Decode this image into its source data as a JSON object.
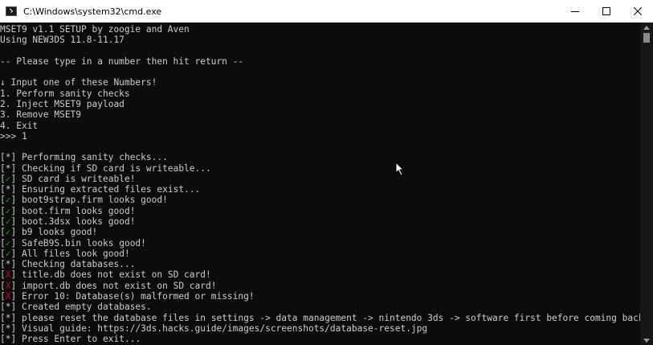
{
  "window": {
    "title": "C:\\Windows\\system32\\cmd.exe",
    "minimize_icon": "minimize-icon",
    "maximize_icon": "maximize-icon",
    "close_icon": "close-icon"
  },
  "console": {
    "lines": [
      {
        "text": "MSET9 v1.1 SETUP by zoogie and Aven"
      },
      {
        "text": "Using NEW3DS 11.8-11.17"
      },
      {
        "text": ""
      },
      {
        "text": "-- Please type in a number then hit return --"
      },
      {
        "text": ""
      },
      {
        "text": "↓ Input one of these Numbers!"
      },
      {
        "text": "1. Perform sanity checks"
      },
      {
        "text": "2. Inject MSET9 payload"
      },
      {
        "text": "3. Remove MSET9"
      },
      {
        "text": "4. Exit"
      },
      {
        "text": ">>> 1"
      },
      {
        "text": ""
      },
      {
        "mark": "*",
        "status": "info",
        "text": " Performing sanity checks..."
      },
      {
        "mark": "*",
        "status": "info",
        "text": " Checking if SD card is writeable..."
      },
      {
        "mark": "✓",
        "status": "ok",
        "text": " SD card is writeable!"
      },
      {
        "mark": "*",
        "status": "info",
        "text": " Ensuring extracted files exist..."
      },
      {
        "mark": "✓",
        "status": "ok",
        "text": " boot9strap.firm looks good!"
      },
      {
        "mark": "✓",
        "status": "ok",
        "text": " boot.firm looks good!"
      },
      {
        "mark": "✓",
        "status": "ok",
        "text": " boot.3dsx looks good!"
      },
      {
        "mark": "✓",
        "status": "ok",
        "text": " b9 looks good!"
      },
      {
        "mark": "✓",
        "status": "ok",
        "text": " SafeB9S.bin looks good!"
      },
      {
        "mark": "✓",
        "status": "ok",
        "text": " All files look good!"
      },
      {
        "mark": "*",
        "status": "info",
        "text": " Checking databases..."
      },
      {
        "mark": "X",
        "status": "err",
        "text": " title.db does not exist on SD card!"
      },
      {
        "mark": "X",
        "status": "err",
        "text": " import.db does not exist on SD card!"
      },
      {
        "mark": "X",
        "status": "err",
        "text": " Error 10: Database(s) malformed or missing!"
      },
      {
        "mark": "*",
        "status": "info",
        "text": " Created empty databases."
      },
      {
        "mark": "*",
        "status": "info",
        "text": " please reset the database files in settings -> data management -> nintendo 3ds -> software first before coming back!"
      },
      {
        "mark": "*",
        "status": "info",
        "text": " Visual guide: https://3ds.hacks.guide/images/screenshots/database-reset.jpg"
      },
      {
        "mark": "*",
        "status": "info",
        "text": " Press Enter to exit..."
      }
    ]
  },
  "colors": {
    "background": "#0c0c0c",
    "text": "#cccccc",
    "ok": "#13a10e",
    "error": "#c50f1f",
    "titlebar": "#ffffff"
  }
}
